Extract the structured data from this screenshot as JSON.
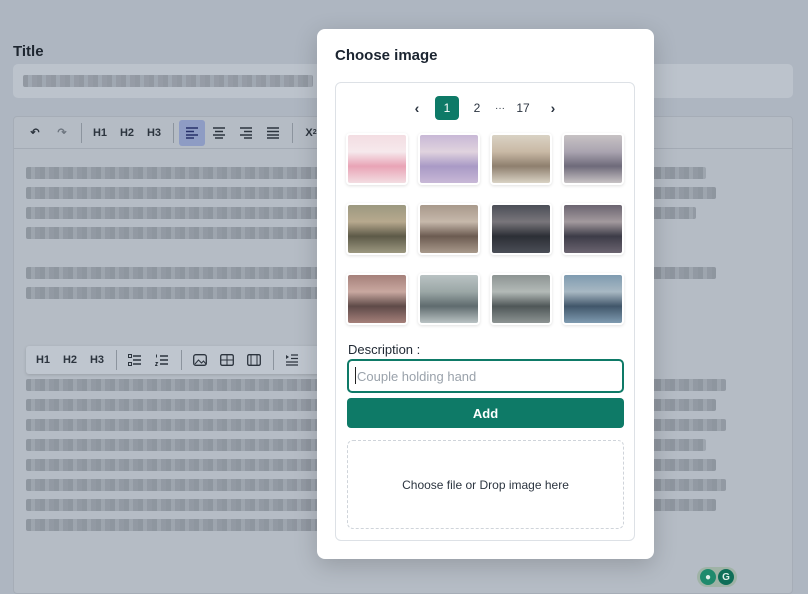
{
  "page": {
    "title_label": "Title"
  },
  "editor": {
    "toolbar": [
      "undo-icon",
      "redo-icon",
      "H1",
      "H2",
      "H3",
      "align-left-icon",
      "align-center-icon",
      "align-right-icon",
      "align-justify-icon",
      "subscript-icon"
    ],
    "float_toolbar": [
      "H1",
      "H2",
      "H3",
      "bullet-list-icon",
      "numbered-list-icon",
      "image-icon",
      "table-icon",
      "video-icon",
      "indent-icon"
    ]
  },
  "modal": {
    "title": "Choose image",
    "pagination": {
      "prev": "‹",
      "pages": [
        "1",
        "2",
        "···",
        "17"
      ],
      "current": "1",
      "next": "›"
    },
    "images": [
      {
        "colors": [
          "#f3dde2",
          "#e9a4b6",
          "#f6e9ec"
        ]
      },
      {
        "colors": [
          "#c8b8d6",
          "#a99ac6",
          "#e0d3de"
        ]
      },
      {
        "colors": [
          "#d9d2c4",
          "#8e7f6e",
          "#c9b9a5"
        ]
      },
      {
        "colors": [
          "#c7c2c4",
          "#6e6a7a",
          "#aaa4b0"
        ]
      },
      {
        "colors": [
          "#9c9880",
          "#5d5a48",
          "#b7a98e"
        ]
      },
      {
        "colors": [
          "#a8998b",
          "#6c5b51",
          "#c6b8ab"
        ]
      },
      {
        "colors": [
          "#4b4e57",
          "#2c2f36",
          "#79767b"
        ]
      },
      {
        "colors": [
          "#6b6470",
          "#3d3c48",
          "#a39a9e"
        ]
      },
      {
        "colors": [
          "#a5807a",
          "#5e4a48",
          "#c9a8a0"
        ]
      },
      {
        "colors": [
          "#b9c2c3",
          "#5f6b6e",
          "#9ba7a6"
        ]
      },
      {
        "colors": [
          "#8d9493",
          "#4f5758",
          "#b3bab7"
        ]
      },
      {
        "colors": [
          "#7f9bb0",
          "#41566a",
          "#a8b8c3"
        ]
      }
    ],
    "description": {
      "label": "Description :",
      "placeholder": "Couple holding hand",
      "value": ""
    },
    "add_label": "Add",
    "dropzone_label": "Choose file or Drop image here"
  },
  "colors": {
    "accent": "#0e7a67",
    "backdrop": "#aeb6c1"
  },
  "grammar_badge": "G"
}
